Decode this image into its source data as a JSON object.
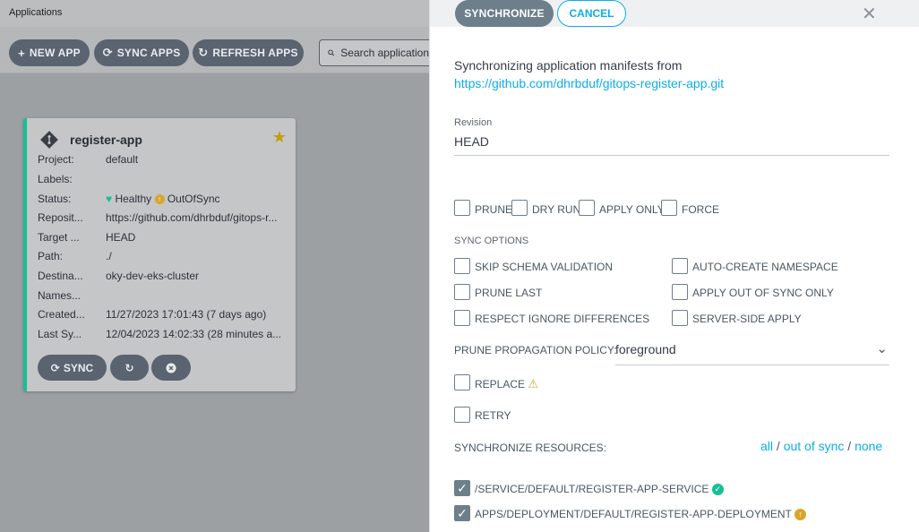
{
  "app": {
    "title": "Applications"
  },
  "toolbar": {
    "new_app": "NEW APP",
    "sync_apps": "SYNC APPS",
    "refresh_apps": "REFRESH APPS",
    "search_placeholder": "Search applications..."
  },
  "card": {
    "name": "register-app",
    "fields": [
      {
        "key": "Project:",
        "value": "default"
      },
      {
        "key": "Labels:",
        "value": ""
      },
      {
        "key": "Status:",
        "value": ""
      },
      {
        "key": "Reposit...",
        "value": "https://github.com/dhrbduf/gitops-r..."
      },
      {
        "key": "Target ...",
        "value": "HEAD"
      },
      {
        "key": "Path:",
        "value": "./"
      },
      {
        "key": "Destina...",
        "value": "oky-dev-eks-cluster"
      },
      {
        "key": "Names...",
        "value": ""
      },
      {
        "key": "Created...",
        "value": "11/27/2023 17:01:43  (7 days ago)"
      },
      {
        "key": "Last Sy...",
        "value": "12/04/2023 14:02:33  (28 minutes a..."
      }
    ],
    "health": "Healthy",
    "sync_status": "OutOfSync",
    "sync_button": "SYNC"
  },
  "panel": {
    "synchronize_button": "SYNCHRONIZE",
    "cancel_button": "CANCEL",
    "sync_from_text": "Synchronizing application manifests from",
    "repo_url": "https://github.com/dhrbduf/gitops-register-app.git",
    "revision_label": "Revision",
    "revision_value": "HEAD",
    "top_options": [
      {
        "label": "PRUNE",
        "checked": false
      },
      {
        "label": "DRY RUN",
        "checked": false
      },
      {
        "label": "APPLY ONLY",
        "checked": false
      },
      {
        "label": "FORCE",
        "checked": false
      }
    ],
    "sync_options_label": "SYNC OPTIONS",
    "sync_options": [
      {
        "label": "SKIP SCHEMA VALIDATION",
        "checked": false
      },
      {
        "label": "AUTO-CREATE NAMESPACE",
        "checked": false
      },
      {
        "label": "PRUNE LAST",
        "checked": false
      },
      {
        "label": "APPLY OUT OF SYNC ONLY",
        "checked": false
      },
      {
        "label": "RESPECT IGNORE DIFFERENCES",
        "checked": false
      },
      {
        "label": "SERVER-SIDE APPLY",
        "checked": false
      }
    ],
    "prune_policy_label": "PRUNE PROPAGATION POLICY:",
    "prune_policy_value": "foreground",
    "replace_label": "REPLACE",
    "retry_label": "RETRY",
    "sync_resources_label": "SYNCHRONIZE RESOURCES:",
    "resource_filters": {
      "all": "all",
      "sep1": "/",
      "out_of_sync": "out of sync",
      "sep2": "/",
      "none": "none"
    },
    "resources": [
      {
        "label": "/SERVICE/DEFAULT/REGISTER-APP-SERVICE",
        "checked": true,
        "status": "synced"
      },
      {
        "label": "APPS/DEPLOYMENT/DEFAULT/REGISTER-APP-DEPLOYMENT",
        "checked": true,
        "status": "out-of-sync"
      }
    ]
  },
  "colors": {
    "accent": "#0dadea",
    "healthy": "#18be94",
    "warning": "#d8a62a",
    "button": "#6d7f8b"
  }
}
